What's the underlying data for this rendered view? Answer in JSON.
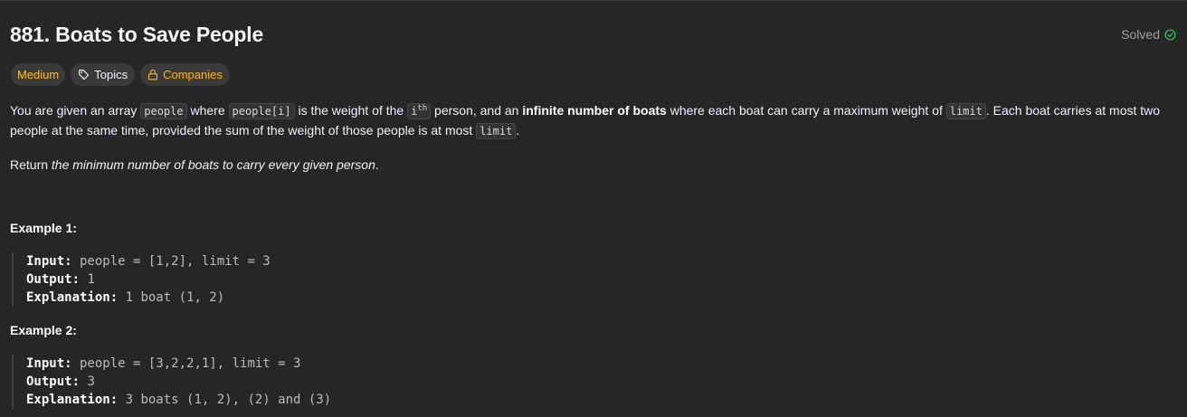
{
  "problem": {
    "title": "881. Boats to Save People",
    "status": "Solved"
  },
  "tags": {
    "difficulty": "Medium",
    "topics": "Topics",
    "companies": "Companies"
  },
  "description": {
    "p1_a": "You are given an array ",
    "code_people": "people",
    "p1_b": " where ",
    "code_people_i": "people[i]",
    "p1_c": " is the weight of the ",
    "code_ith_base": "i",
    "code_ith_sup": "th",
    "p1_d": " person, and an ",
    "bold_boats": "infinite number of boats",
    "p1_e": " where each boat can carry a maximum weight of ",
    "code_limit": "limit",
    "p1_f": ". Each boat carries at most two people at the same time, provided the sum of the weight of those people is at most ",
    "code_limit2": "limit",
    "p1_g": ".",
    "p2_a": "Return ",
    "p2_italic": "the minimum number of boats to carry every given person",
    "p2_b": "."
  },
  "examples": [
    {
      "title": "Example 1:",
      "input_label": "Input:",
      "input_value": " people = [1,2], limit = 3",
      "output_label": "Output:",
      "output_value": " 1",
      "explanation_label": "Explanation:",
      "explanation_value": " 1 boat (1, 2)"
    },
    {
      "title": "Example 2:",
      "input_label": "Input:",
      "input_value": " people = [3,2,2,1], limit = 3",
      "output_label": "Output:",
      "output_value": " 3",
      "explanation_label": "Explanation:",
      "explanation_value": " 3 boats (1, 2), (2) and (3)"
    }
  ],
  "colors": {
    "background": "#262626",
    "medium": "#ffc01e",
    "companies": "#ffb800",
    "solved_check": "#2cbb5d"
  },
  "icons": {
    "solved": "check-circle-icon",
    "topics": "tag-icon",
    "companies": "lock-icon"
  }
}
